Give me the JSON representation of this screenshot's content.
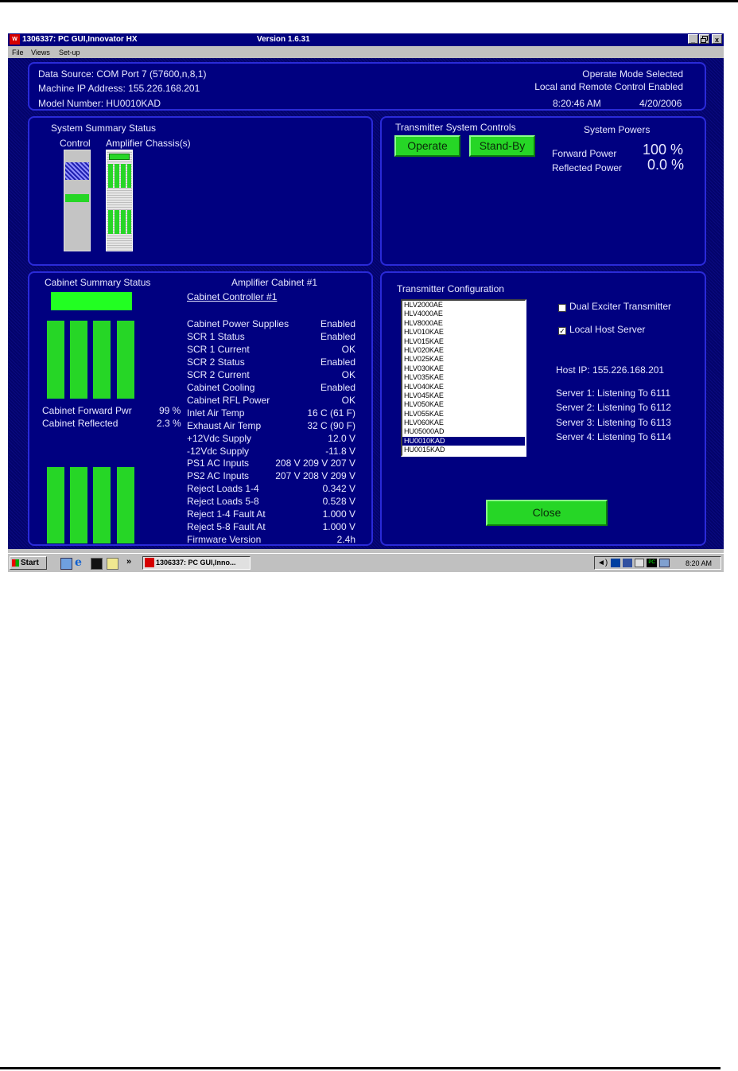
{
  "window": {
    "title": "1306337: PC GUI,Innovator HX",
    "version": "Version 1.6.31",
    "buttons": {
      "minimize": "_",
      "restore": "á",
      "close": "x"
    }
  },
  "menu": {
    "items": [
      "File",
      "Views",
      "Set-up"
    ]
  },
  "header": {
    "data_source": "Data Source: COM Port 7 (57600,n,8,1)",
    "ip_address": "Machine IP Address: 155.226.168.201",
    "model_number": "Model Number: HU0010KAD",
    "mode": "Operate Mode Selected",
    "control": "Local and Remote Control Enabled",
    "time": "8:20:46 AM",
    "date": "4/20/2006"
  },
  "system_summary": {
    "title": "System Summary Status",
    "control_label": "Control",
    "amplifier_label": "Amplifier Chassis(s)"
  },
  "tx_controls": {
    "title": "Transmitter System Controls",
    "operate_label": "Operate",
    "standby_label": "Stand-By",
    "powers_title": "System Powers",
    "forward_label": "Forward Power",
    "forward_value": "100 %",
    "reflected_label": "Reflected Power",
    "reflected_value": "0.0 %"
  },
  "cabinet_summary": {
    "title": "Cabinet Summary Status",
    "forward_label": "Cabinet Forward Pwr",
    "forward_value": "99 %",
    "reflected_label": "Cabinet Reflected",
    "reflected_value": "2.3 %"
  },
  "amp_cabinet": {
    "title": "Amplifier Cabinet #1",
    "controller_link": "Cabinet Controller #1",
    "rows": [
      {
        "label": "Cabinet Power Supplies",
        "value": "Enabled"
      },
      {
        "label": "SCR 1 Status",
        "value": "Enabled"
      },
      {
        "label": "SCR 1 Current",
        "value": "OK"
      },
      {
        "label": "SCR 2 Status",
        "value": "Enabled"
      },
      {
        "label": "SCR 2 Current",
        "value": "OK"
      },
      {
        "label": "Cabinet Cooling",
        "value": "Enabled"
      },
      {
        "label": "Cabinet RFL Power",
        "value": "OK"
      },
      {
        "label": "Inlet Air Temp",
        "value": "16 C (61 F)"
      },
      {
        "label": "Exhaust Air Temp",
        "value": "32 C (90 F)"
      },
      {
        "label": "+12Vdc Supply",
        "value": "12.0 V"
      },
      {
        "label": "-12Vdc Supply",
        "value": "-11.8 V"
      },
      {
        "label": "PS1 AC Inputs",
        "value": "208 V  209 V  207 V"
      },
      {
        "label": "PS2 AC Inputs",
        "value": "207 V  208 V  209 V"
      },
      {
        "label": "Reject Loads 1-4",
        "value": "0.342 V"
      },
      {
        "label": "Reject Loads 5-8",
        "value": "0.528 V"
      },
      {
        "label": "Reject 1-4 Fault At",
        "value": "1.000 V"
      },
      {
        "label": "Reject 5-8 Fault At",
        "value": "1.000 V"
      },
      {
        "label": "Firmware Version",
        "value": "2.4h"
      }
    ]
  },
  "tx_config": {
    "title": "Transmitter Configuration",
    "models": [
      "HLV2000AE",
      "HLV4000AE",
      "HLV8000AE",
      "HLV010KAE",
      "HLV015KAE",
      "HLV020KAE",
      "HLV025KAE",
      "HLV030KAE",
      "HLV035KAE",
      "HLV040KAE",
      "HLV045KAE",
      "HLV050KAE",
      "HLV055KAE",
      "HLV060KAE",
      "HU05000AD",
      "HU0010KAD",
      "HU0015KAD"
    ],
    "selected_index": 15,
    "dual_exciter_label": "Dual Exciter Transmitter",
    "dual_exciter_checked": false,
    "local_host_label": "Local Host Server",
    "local_host_checked": true,
    "host_ip": "Host IP: 155.226.168.201",
    "servers": [
      "Server 1: Listening To 6111",
      "Server 2: Listening To 6112",
      "Server 3: Listening To 6113",
      "Server 4: Listening To 6114"
    ],
    "close_label": "Close"
  },
  "taskbar": {
    "start_label": "Start",
    "more": "»",
    "app_label": "1306337: PC GUI,Inno...",
    "clock": "8:20 AM"
  },
  "colors": {
    "panel_bg": "#000080",
    "panel_border": "#2a2ad8",
    "status_green": "#26d626",
    "title_bar": "#00007e"
  }
}
